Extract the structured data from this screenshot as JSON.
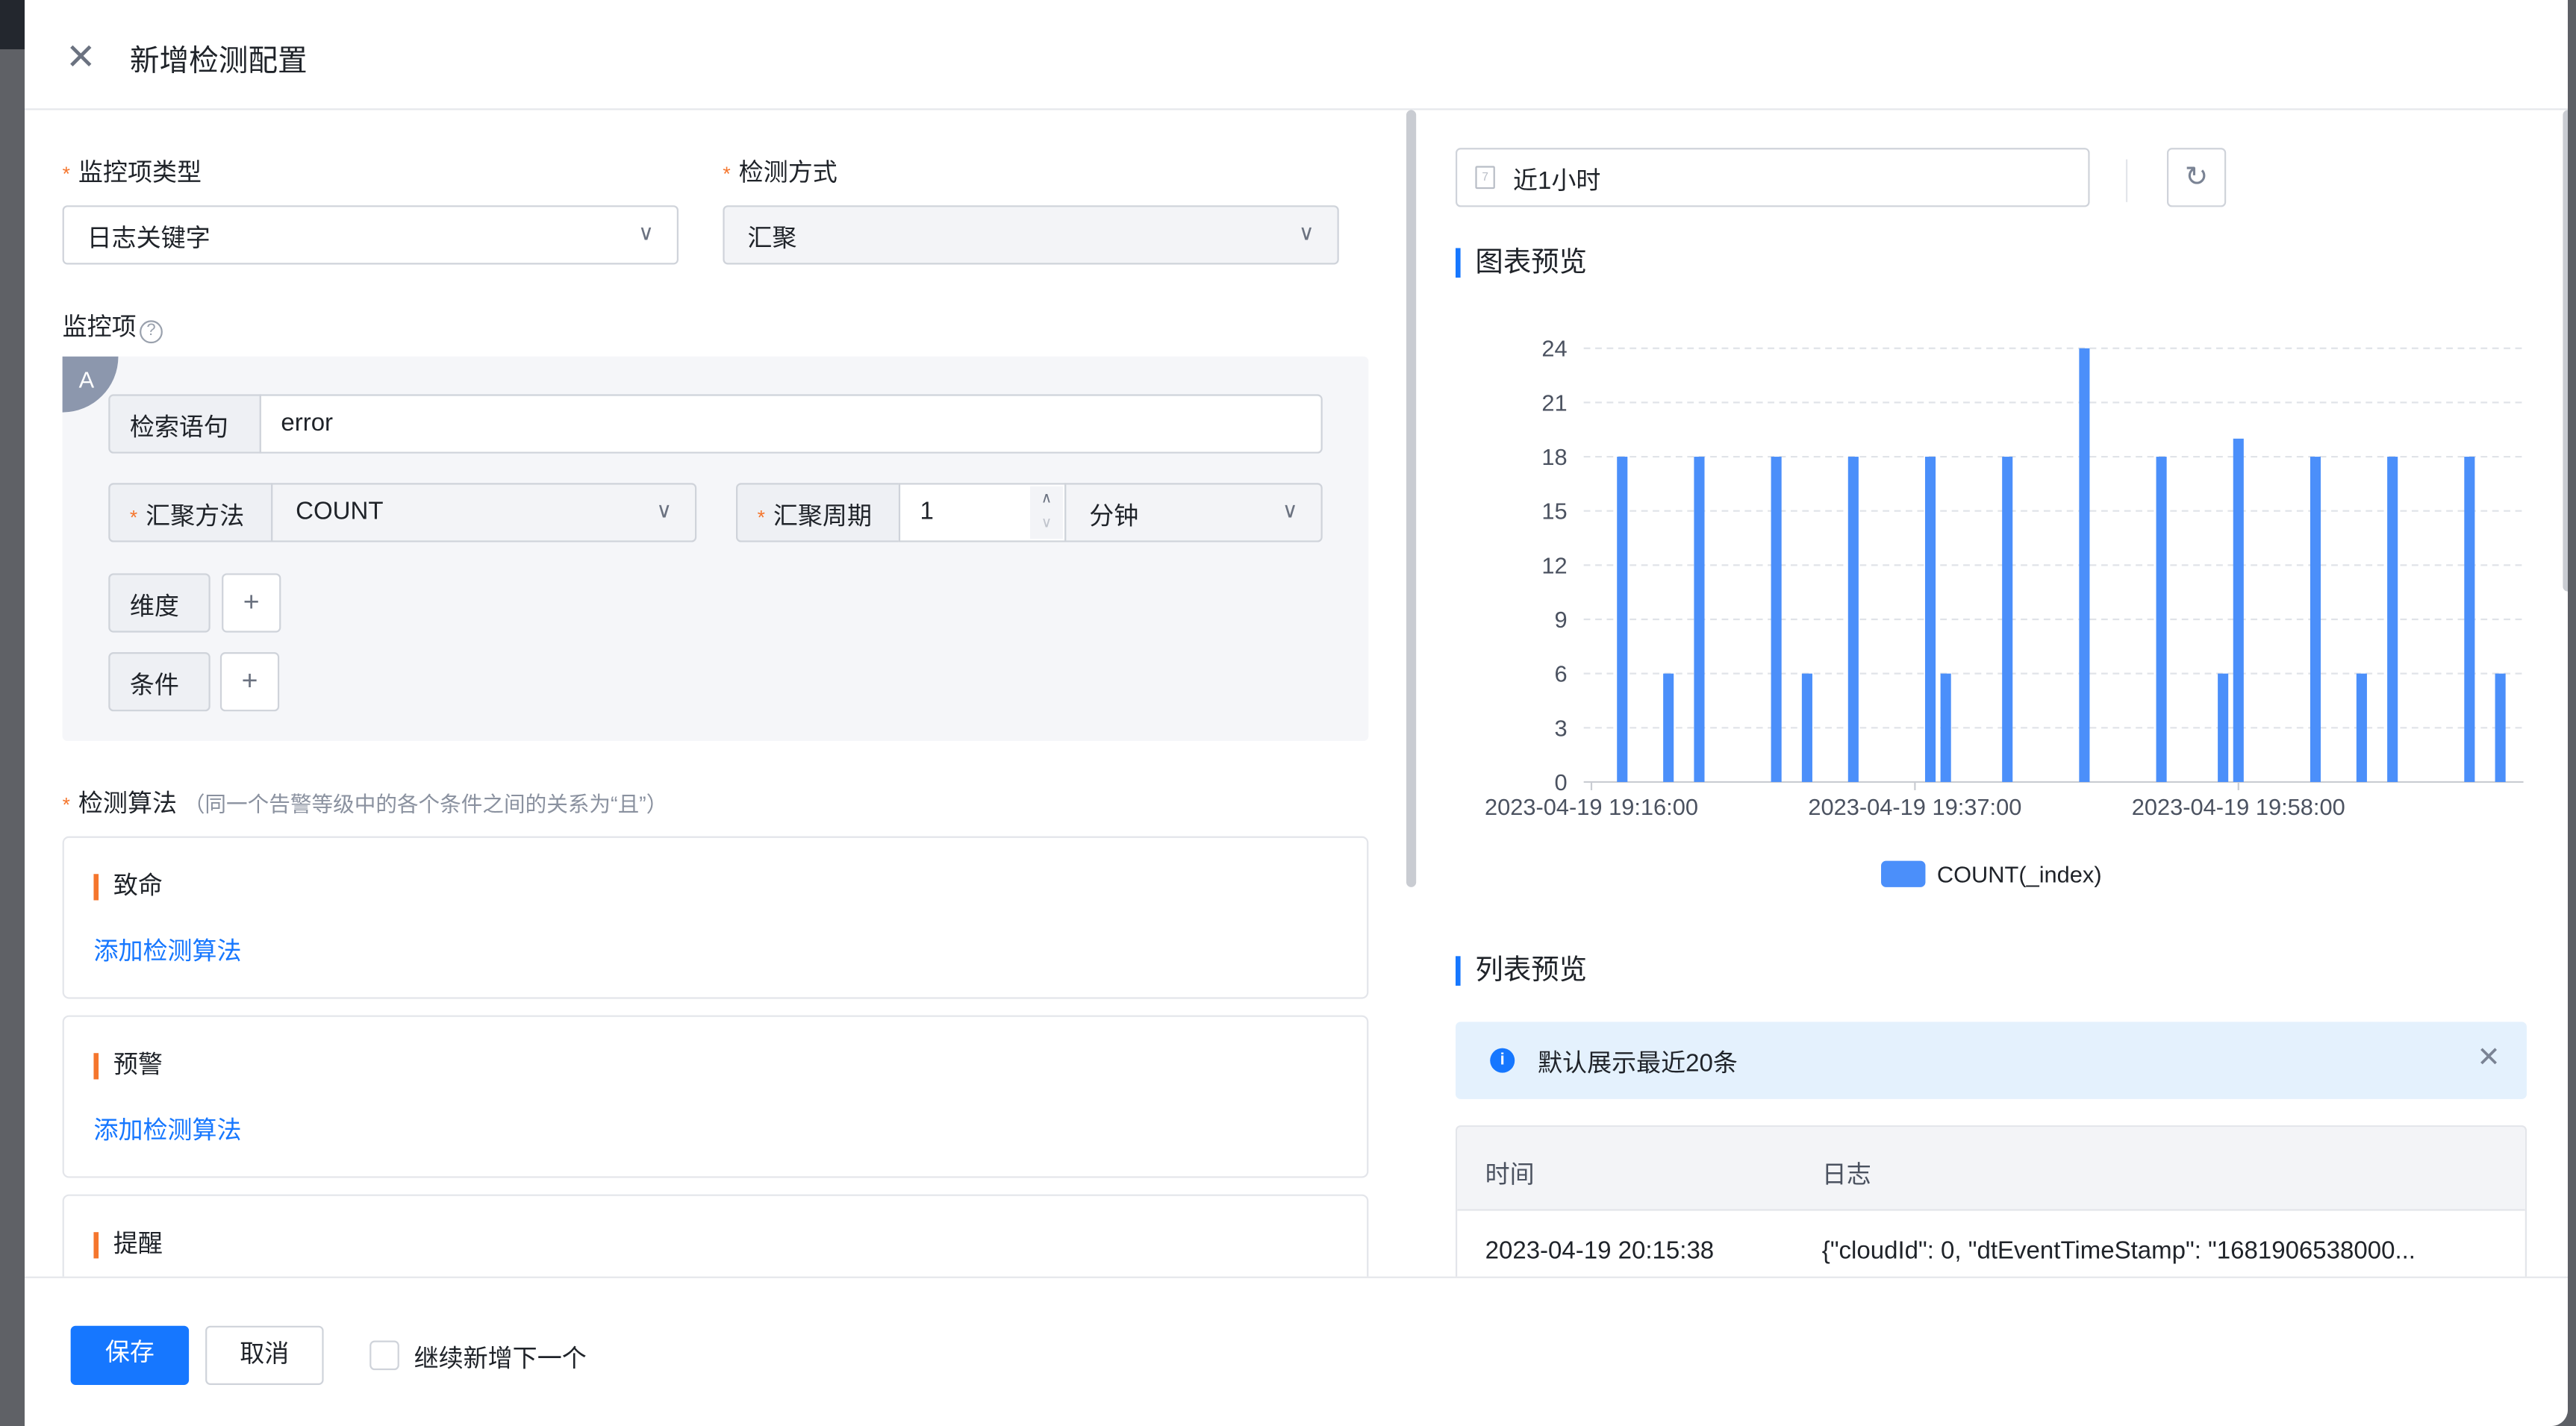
{
  "header": {
    "title": "新增检测配置",
    "close_icon": "close-icon"
  },
  "form": {
    "monitor_type": {
      "label": "监控项类型",
      "value": "日志关键字"
    },
    "detect_mode": {
      "label": "检测方式",
      "value": "汇聚"
    },
    "monitor_item": {
      "label": "监控项",
      "help_icon": "question-circle-icon",
      "badge": "A",
      "query_label": "检索语句",
      "query_value": "error",
      "agg_method_label": "汇聚方法",
      "agg_method_value": "COUNT",
      "agg_period_label": "汇聚周期",
      "agg_period_value": "1",
      "agg_period_unit": "分钟",
      "dimension_label": "维度",
      "condition_label": "条件",
      "add_symbol": "+"
    },
    "algorithm": {
      "label": "检测算法",
      "hint": "（同一个告警等级中的各个条件之间的关系为“且”）",
      "levels": [
        {
          "name": "致命",
          "action": "添加检测算法"
        },
        {
          "name": "预警",
          "action": "添加检测算法"
        },
        {
          "name": "提醒"
        }
      ]
    }
  },
  "footer": {
    "save": "保存",
    "cancel": "取消",
    "continue_label": "继续新增下一个",
    "continue_checked": false
  },
  "preview": {
    "time_range": "近1小时",
    "chart_title": "图表预览",
    "list_title": "列表预览",
    "notice": "默认展示最近20条",
    "table": {
      "columns": [
        "时间",
        "日志"
      ],
      "rows": [
        [
          "2023-04-19 20:15:38",
          "{\"cloudId\": 0, \"dtEventTimeStamp\": \"1681906538000..."
        ]
      ]
    }
  },
  "colors": {
    "primary": "#1677ff",
    "bar": "#4b8ffa",
    "required": "#f5762d"
  },
  "chart_data": {
    "type": "bar",
    "legend": "COUNT(_index)",
    "legend_position": "bottom",
    "grid": true,
    "ylim": [
      0,
      24
    ],
    "yticks": [
      0,
      3,
      6,
      9,
      12,
      15,
      18,
      21,
      24
    ],
    "xticks": [
      "2023-04-19 19:16:00",
      "2023-04-19 19:37:00",
      "2023-04-19 19:58:00"
    ],
    "xlim": [
      "2023-04-19 19:15:30",
      "2023-04-19 20:16:30"
    ],
    "x": [
      "2023-04-19 19:18:00",
      "2023-04-19 19:21:00",
      "2023-04-19 19:23:00",
      "2023-04-19 19:28:00",
      "2023-04-19 19:30:00",
      "2023-04-19 19:33:00",
      "2023-04-19 19:38:00",
      "2023-04-19 19:39:00",
      "2023-04-19 19:43:00",
      "2023-04-19 19:48:00",
      "2023-04-19 19:53:00",
      "2023-04-19 19:57:00",
      "2023-04-19 19:58:00",
      "2023-04-19 20:03:00",
      "2023-04-19 20:06:00",
      "2023-04-19 20:08:00",
      "2023-04-19 20:13:00",
      "2023-04-19 20:15:00"
    ],
    "values": [
      18,
      6,
      18,
      18,
      6,
      18,
      18,
      6,
      18,
      24,
      18,
      6,
      19,
      18,
      6,
      18,
      18,
      6
    ]
  }
}
